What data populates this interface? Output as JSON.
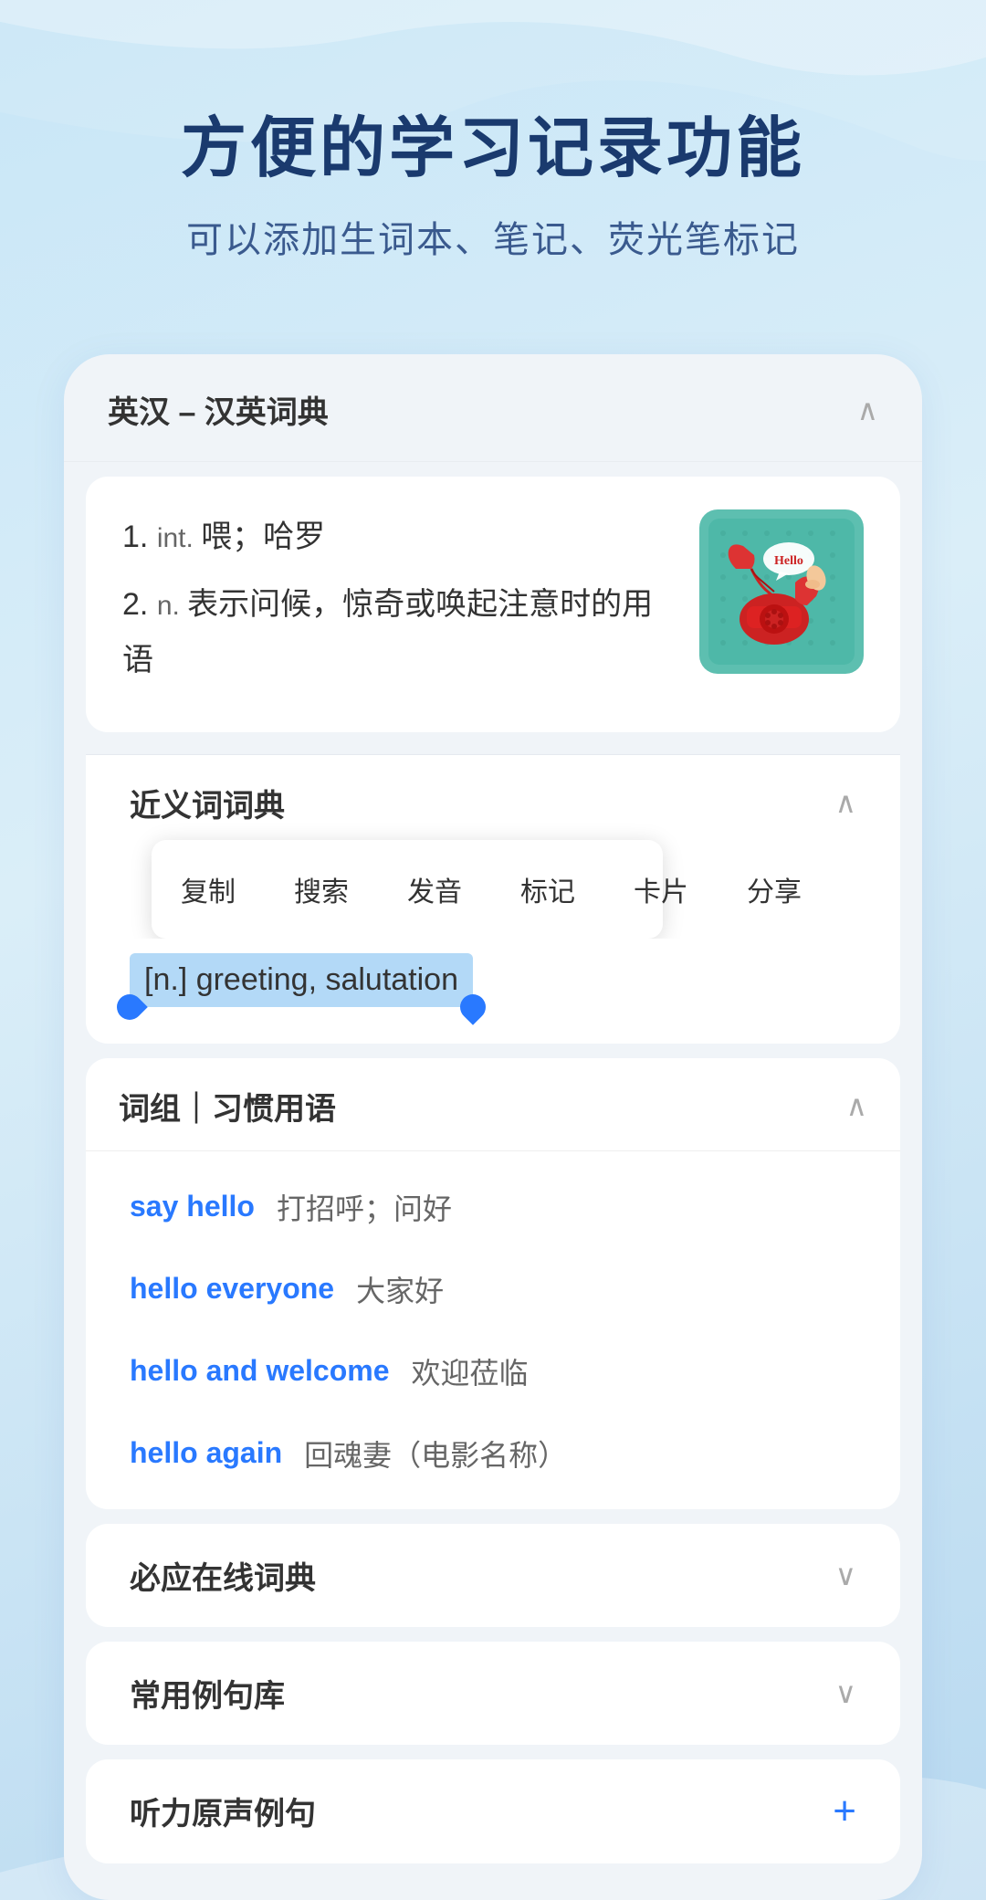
{
  "header": {
    "main_title": "方便的学习记录功能",
    "sub_title": "可以添加生词本、笔记、荧光笔标记"
  },
  "dict_section": {
    "title": "英汉 – 汉英词典",
    "definitions": [
      {
        "index": "1.",
        "type": "int.",
        "text": "喂；哈罗"
      },
      {
        "index": "2.",
        "type": "n.",
        "text": "表示问候，惊奇或唤起注意时的用语"
      }
    ]
  },
  "synonym_section": {
    "title": "近义词词典",
    "context_menu": {
      "items": [
        "复制",
        "搜索",
        "发音",
        "标记",
        "卡片",
        "分享"
      ]
    },
    "selected_text": "[n.] greeting, salutation"
  },
  "phrases_section": {
    "title": "词组｜习惯用语",
    "items": [
      {
        "en": "say hello",
        "zh": "打招呼；问好"
      },
      {
        "en": "hello everyone",
        "zh": "大家好"
      },
      {
        "en": "hello and welcome",
        "zh": "欢迎莅临"
      },
      {
        "en": "hello again",
        "zh": "回魂妻（电影名称）"
      }
    ]
  },
  "collapsed_sections": [
    {
      "title": "必应在线词典"
    },
    {
      "title": "常用例句库"
    }
  ],
  "last_section": {
    "title": "听力原声例句"
  },
  "icons": {
    "chevron_up": "∧",
    "chevron_down": "∨",
    "plus": "+"
  }
}
